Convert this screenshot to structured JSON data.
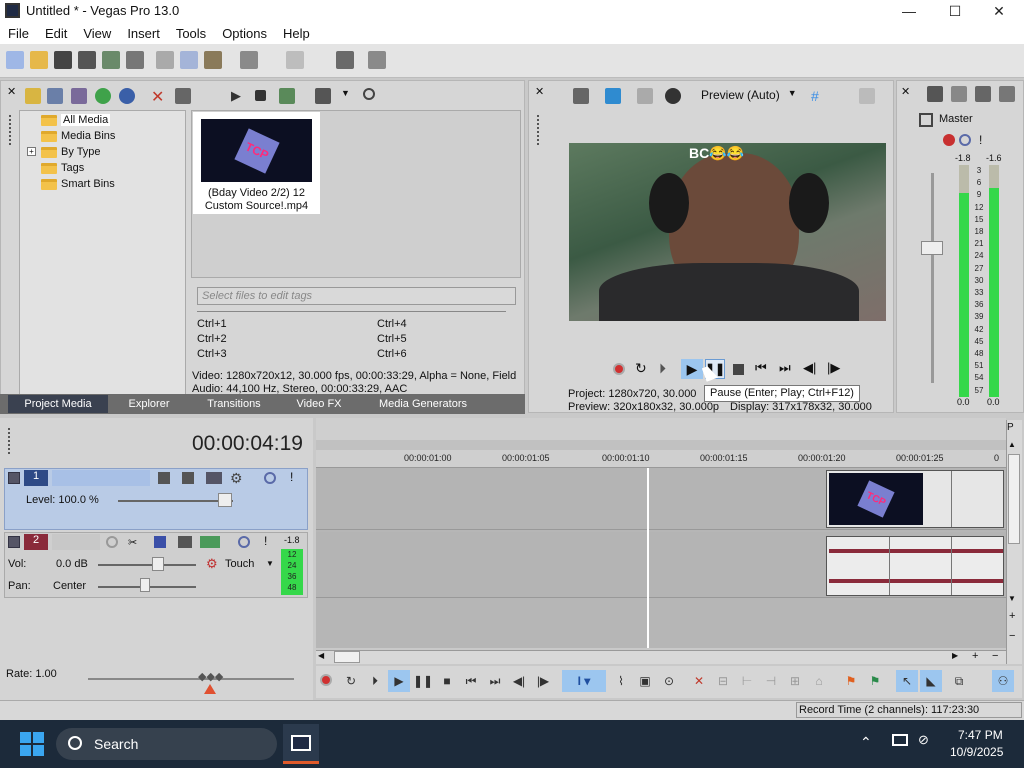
{
  "window": {
    "title": "Untitled * - Vegas Pro 13.0",
    "minimize": "—",
    "maximize": "☐",
    "close": "✕"
  },
  "menu": [
    "File",
    "Edit",
    "View",
    "Insert",
    "Tools",
    "Options",
    "Help"
  ],
  "media_tree": [
    "All Media",
    "Media Bins",
    "By Type",
    "Tags",
    "Smart Bins"
  ],
  "media_item": {
    "line1": "(Bday Video 2/2) 12",
    "line2": "Custom Source!.mp4",
    "thumb_text": "TCP"
  },
  "search_placeholder": "Select files to edit tags",
  "shortcuts": [
    "Ctrl+1",
    "Ctrl+4",
    "Ctrl+2",
    "Ctrl+5",
    "Ctrl+3",
    "Ctrl+6"
  ],
  "media_info": {
    "line1": "Video: 1280x720x12, 30.000 fps, 00:00:33:29, Alpha = None, Field",
    "line2": "Audio: 44,100 Hz, Stereo, 00:00:33:29, AAC"
  },
  "tabs": [
    "Project Media",
    "Explorer",
    "Transitions",
    "Video FX",
    "Media Generators"
  ],
  "preview": {
    "mode": "Preview (Auto)",
    "overlay_text": "BC😂😂",
    "tooltip": "Pause (Enter; Play; Ctrl+F12)",
    "project_line": "Project:  1280x720, 30.000",
    "preview_line": "Preview:  320x180x32, 30.000p",
    "display_line": "Display:  317x178x32, 30.000"
  },
  "master": {
    "label": "Master",
    "peak_l": "-1.8",
    "peak_r": "-1.6",
    "scale": [
      "3",
      "6",
      "9",
      "12",
      "15",
      "18",
      "21",
      "24",
      "27",
      "30",
      "33",
      "36",
      "39",
      "42",
      "45",
      "48",
      "51",
      "54",
      "57"
    ],
    "bottom_l": "0.0",
    "bottom_r": "0.0"
  },
  "timecode": "00:00:04:19",
  "ruler": [
    "00:00:01:00",
    "00:00:01:05",
    "00:00:01:10",
    "00:00:01:15",
    "00:00:01:20",
    "00:00:01:25",
    "0"
  ],
  "track1": {
    "num": "1",
    "level": "Level: 100.0 %",
    "clip_text": "TCP"
  },
  "track2": {
    "num": "2",
    "vol": "Vol:",
    "vol_val": "0.0 dB",
    "pan": "Pan:",
    "pan_val": "Center",
    "mode": "Touch",
    "meter_top": "-1.8",
    "meter_scale": [
      "12",
      "24",
      "36",
      "48"
    ]
  },
  "rate": "Rate: 1.00",
  "record_time": "Record Time (2 channels): 117:23:30",
  "taskbar": {
    "search": "Search",
    "time": "7:47 PM",
    "date": "10/9/2025"
  },
  "colors": {
    "accent": "#3a8ee6",
    "tab_active": "#3a4150",
    "meter_green": "#35d84a",
    "track_blue": "#b9cbe6"
  }
}
